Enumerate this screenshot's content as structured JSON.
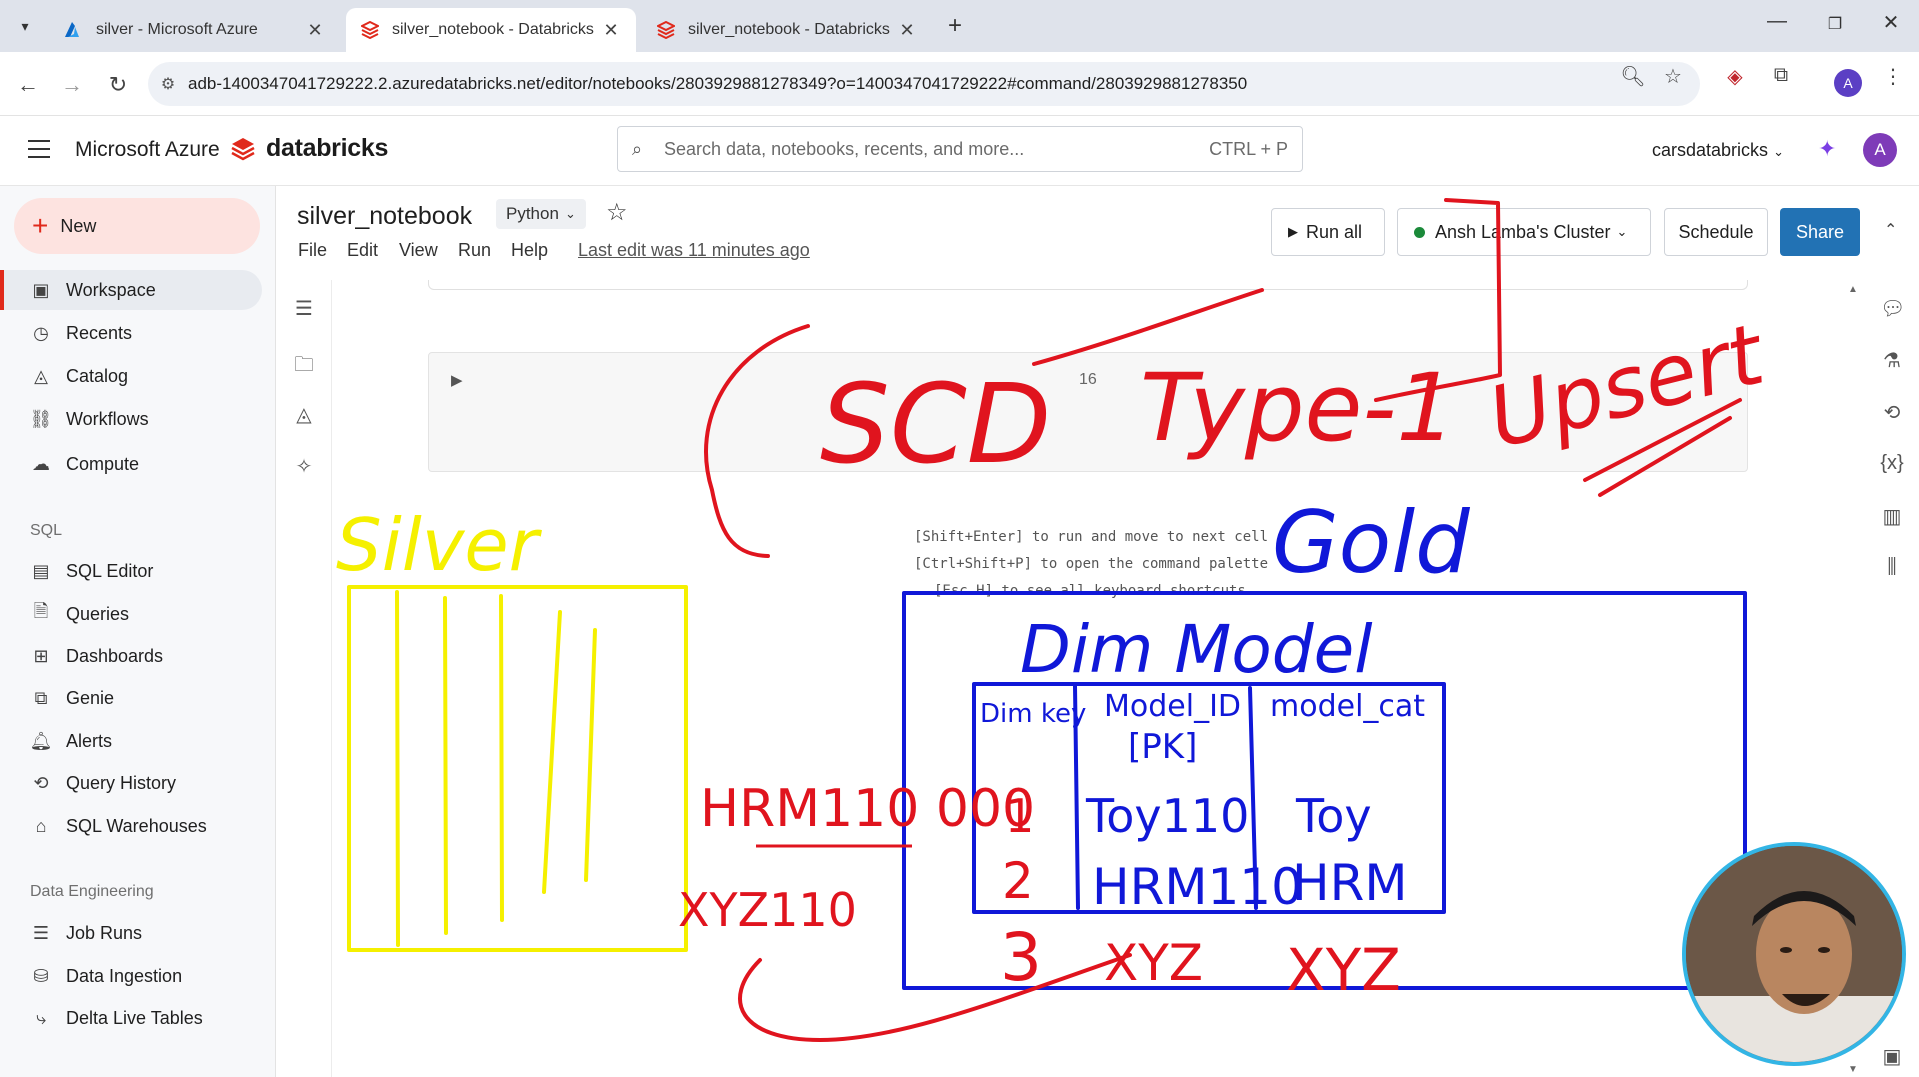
{
  "browser": {
    "tabs": [
      {
        "title": "silver - Microsoft Azure",
        "active": false
      },
      {
        "title": "silver_notebook - Databricks",
        "active": true
      },
      {
        "title": "silver_notebook - Databricks",
        "active": false
      }
    ],
    "url": "adb-1400347041729222.2.azuredatabricks.net/editor/notebooks/2803929881278349?o=1400347041729222#command/2803929881278350",
    "profile_initial": "A"
  },
  "header": {
    "azure_label": "Microsoft Azure",
    "brand": "databricks",
    "search_placeholder": "Search data, notebooks, recents, and more...",
    "search_shortcut": "CTRL + P",
    "workspace": "carsdatabricks",
    "user_initial": "A"
  },
  "sidebar": {
    "new_label": "New",
    "items": [
      {
        "label": "Workspace",
        "icon": "workspace-icon"
      },
      {
        "label": "Recents",
        "icon": "clock-icon"
      },
      {
        "label": "Catalog",
        "icon": "catalog-icon"
      },
      {
        "label": "Workflows",
        "icon": "workflows-icon"
      },
      {
        "label": "Compute",
        "icon": "cloud-icon"
      }
    ],
    "sql_section": "SQL",
    "sql_items": [
      {
        "label": "SQL Editor"
      },
      {
        "label": "Queries"
      },
      {
        "label": "Dashboards"
      },
      {
        "label": "Genie"
      },
      {
        "label": "Alerts"
      },
      {
        "label": "Query History"
      },
      {
        "label": "SQL Warehouses"
      }
    ],
    "de_section": "Data Engineering",
    "de_items": [
      {
        "label": "Job Runs"
      },
      {
        "label": "Data Ingestion"
      },
      {
        "label": "Delta Live Tables"
      }
    ]
  },
  "notebook": {
    "title": "silver_notebook",
    "language": "Python",
    "menu": [
      "File",
      "Edit",
      "View",
      "Run",
      "Help"
    ],
    "last_edit": "Last edit was 11 minutes ago",
    "run_all": "Run all",
    "cluster": "Ansh Lamba's Cluster",
    "schedule": "Schedule",
    "share": "Share",
    "cell_number": "16",
    "hints": [
      "[Shift+Enter] to run and move to next cell",
      "[Ctrl+Shift+P] to open the command palette",
      "[Esc H] to see all keyboard shortcuts"
    ]
  },
  "annotations": {
    "scd": "SCD",
    "type1": "Type-1",
    "upsert": "Upsert",
    "gold": "Gold",
    "silver": "Silver",
    "dim_model": "Dim Model",
    "col_dim_key": "Dim key",
    "col_model_id": "Model_ID",
    "col_model_id_pk": "[PK]",
    "col_model_cat": "model_cat",
    "rows": [
      {
        "key": "1",
        "id": "Toy110",
        "cat": "Toy"
      },
      {
        "key": "2",
        "id": "HRM110",
        "cat": "HRM"
      },
      {
        "key": "3",
        "id": "XYZ",
        "cat": "XYZ"
      }
    ],
    "new_record_1": "HRM110 000",
    "new_record_2": "XYZ110",
    "colors": {
      "red": "#e0141e",
      "blue": "#1018d8",
      "yellow": "#f5f000"
    }
  }
}
